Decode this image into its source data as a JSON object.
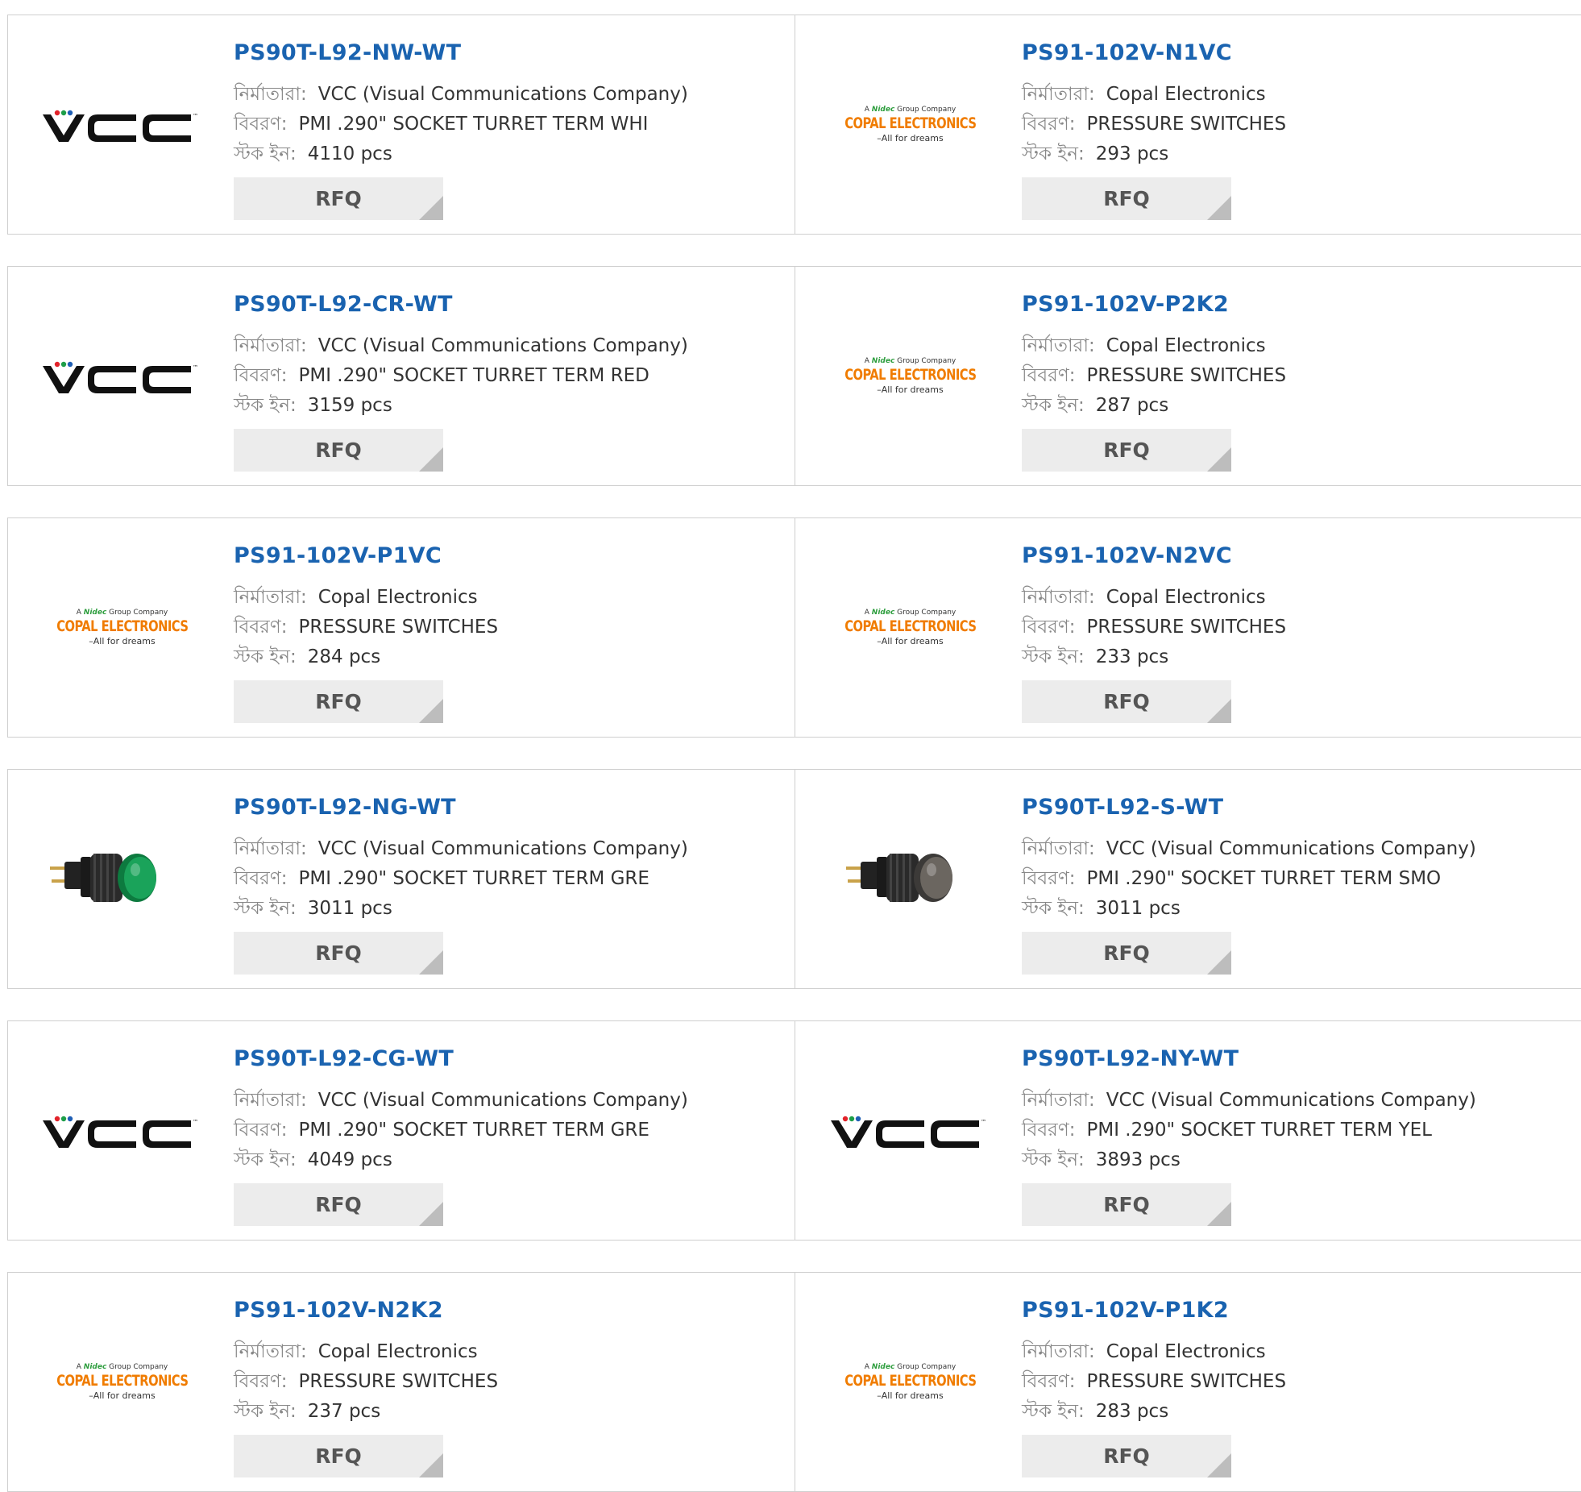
{
  "labels": {
    "manufacturer": "নির্মাতারা:",
    "description": "বিবরণ:",
    "stock": "স্টক ইন:"
  },
  "brand_logos": {
    "vcc": {
      "text": "VCC",
      "tm": "™",
      "colors": [
        "#e2232a",
        "#1d9e48",
        "#1f5fb5"
      ]
    },
    "copal": {
      "tagline_top": "A Nidec Group Company",
      "name": "COPAL ELECTRONICS",
      "tagline_bottom": "–All for dreams",
      "color": "#f07c00",
      "nidec_color": "#2e9e3e"
    }
  },
  "rows": [
    [
      {
        "part": "PS90T-L92-NW-WT",
        "manufacturer": "VCC (Visual Communications Company)",
        "description": "PMI .290\" SOCKET TURRET TERM WHI",
        "stock": "4110 pcs",
        "rfq": "RFQ",
        "image": "vcc-logo"
      },
      {
        "part": "PS91-102V-N1VC",
        "manufacturer": "Copal Electronics",
        "description": "PRESSURE SWITCHES",
        "stock": "293 pcs",
        "rfq": "RFQ",
        "image": "copal-logo"
      }
    ],
    [
      {
        "part": "PS90T-L92-CR-WT",
        "manufacturer": "VCC (Visual Communications Company)",
        "description": "PMI .290\" SOCKET TURRET TERM RED",
        "stock": "3159 pcs",
        "rfq": "RFQ",
        "image": "vcc-logo"
      },
      {
        "part": "PS91-102V-P2K2",
        "manufacturer": "Copal Electronics",
        "description": "PRESSURE SWITCHES",
        "stock": "287 pcs",
        "rfq": "RFQ",
        "image": "copal-logo"
      }
    ],
    [
      {
        "part": "PS91-102V-P1VC",
        "manufacturer": "Copal Electronics",
        "description": "PRESSURE SWITCHES",
        "stock": "284 pcs",
        "rfq": "RFQ",
        "image": "copal-logo"
      },
      {
        "part": "PS91-102V-N2VC",
        "manufacturer": "Copal Electronics",
        "description": "PRESSURE SWITCHES",
        "stock": "233 pcs",
        "rfq": "RFQ",
        "image": "copal-logo"
      }
    ],
    [
      {
        "part": "PS90T-L92-NG-WT",
        "manufacturer": "VCC (Visual Communications Company)",
        "description": "PMI .290\" SOCKET TURRET TERM GRE",
        "stock": "3011 pcs",
        "rfq": "RFQ",
        "image": "green-socket-photo"
      },
      {
        "part": "PS90T-L92-S-WT",
        "manufacturer": "VCC (Visual Communications Company)",
        "description": "PMI .290\" SOCKET TURRET TERM SMO",
        "stock": "3011 pcs",
        "rfq": "RFQ",
        "image": "smoke-socket-photo"
      }
    ],
    [
      {
        "part": "PS90T-L92-CG-WT",
        "manufacturer": "VCC (Visual Communications Company)",
        "description": "PMI .290\" SOCKET TURRET TERM GRE",
        "stock": "4049 pcs",
        "rfq": "RFQ",
        "image": "vcc-logo"
      },
      {
        "part": "PS90T-L92-NY-WT",
        "manufacturer": "VCC (Visual Communications Company)",
        "description": "PMI .290\" SOCKET TURRET TERM YEL",
        "stock": "3893 pcs",
        "rfq": "RFQ",
        "image": "vcc-logo"
      }
    ],
    [
      {
        "part": "PS91-102V-N2K2",
        "manufacturer": "Copal Electronics",
        "description": "PRESSURE SWITCHES",
        "stock": "237 pcs",
        "rfq": "RFQ",
        "image": "copal-logo"
      },
      {
        "part": "PS91-102V-P1K2",
        "manufacturer": "Copal Electronics",
        "description": "PRESSURE SWITCHES",
        "stock": "283 pcs",
        "rfq": "RFQ",
        "image": "copal-logo"
      }
    ]
  ],
  "colors": {
    "part_link": "#1a63b0",
    "border": "#cfcfcf",
    "rfq_bg": "#ececec"
  }
}
